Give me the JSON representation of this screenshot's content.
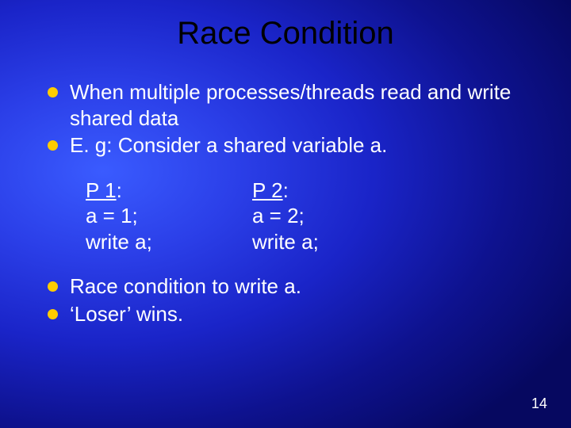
{
  "title": "Race Condition",
  "bullets_top": [
    "When multiple processes/threads read and write shared data",
    "E. g: Consider a shared variable a."
  ],
  "code": {
    "p1": {
      "label": "P 1",
      "l1": "a = 1;",
      "l2": "write a;"
    },
    "p2": {
      "label": "P 2",
      "l1": "a = 2;",
      "l2": "write a;"
    }
  },
  "bullets_bottom": [
    "Race condition to write a.",
    "‘Loser’ wins."
  ],
  "page_number": "14"
}
